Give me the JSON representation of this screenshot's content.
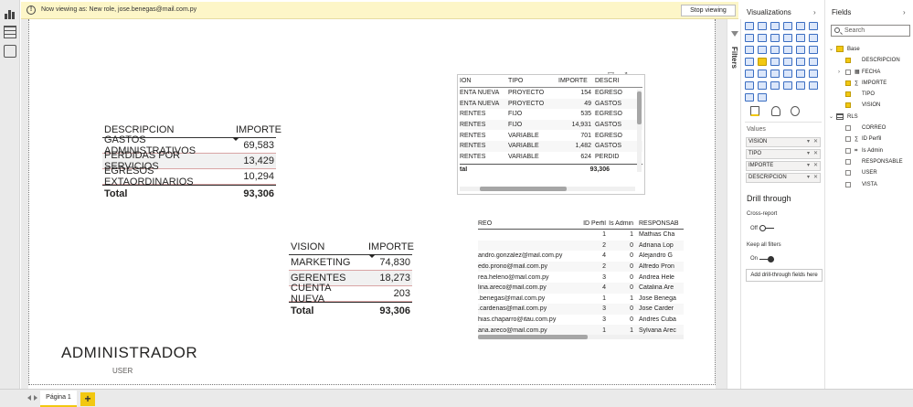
{
  "banner": {
    "text": "Now viewing as: New role, jose.benegas@mail.com.py",
    "stop_button": "Stop viewing"
  },
  "table_descripcion": {
    "headers": [
      "DESCRIPCION",
      "IMPORTE"
    ],
    "rows": [
      {
        "label": "GASTOS ADMINISTRATIVOS",
        "value": "69,583"
      },
      {
        "label": "PERDIDAS POR SERVICIOS",
        "value": "13,429"
      },
      {
        "label": "EGRESOS EXTAORDINARIOS",
        "value": "10,294"
      }
    ],
    "total_label": "Total",
    "total_value": "93,306"
  },
  "table_vision": {
    "headers": [
      "VISION",
      "IMPORTE"
    ],
    "rows": [
      {
        "label": "MARKETING",
        "value": "74,830"
      },
      {
        "label": "GERENTES",
        "value": "18,273"
      },
      {
        "label": "CUENTA NUEVA",
        "value": "203"
      }
    ],
    "total_label": "Total",
    "total_value": "93,306"
  },
  "table_detail": {
    "headers": [
      "ION",
      "TIPO",
      "IMPORTE",
      "DESCRI"
    ],
    "rows": [
      [
        "ENTA NUEVA",
        "PROYECTO",
        "154",
        "EGRESOS"
      ],
      [
        "ENTA NUEVA",
        "PROYECTO",
        "49",
        "GASTOS"
      ],
      [
        "RENTES",
        "FIJO",
        "535",
        "EGRESO"
      ],
      [
        "RENTES",
        "FIJO",
        "14,931",
        "GASTOS"
      ],
      [
        "RENTES",
        "VARIABLE",
        "701",
        "EGRESO"
      ],
      [
        "RENTES",
        "VARIABLE",
        "1,482",
        "GASTOS"
      ],
      [
        "RENTES",
        "VARIABLE",
        "624",
        "PERDID"
      ]
    ],
    "total_label": "tal",
    "total_value": "93,306"
  },
  "table_users": {
    "headers": [
      "REO",
      "ID Perfil",
      "Is Admin",
      "RESPONSAB"
    ],
    "rows": [
      [
        "",
        "1",
        "1",
        "Mathias Cha"
      ],
      [
        "",
        "2",
        "0",
        "Adriana Lop"
      ],
      [
        "andro.gonzalez@mail.com.py",
        "4",
        "0",
        "Alejandro G"
      ],
      [
        "edo.prono@mail.com.py",
        "2",
        "0",
        "Alfredo Pron"
      ],
      [
        "rea.heleno@mail.com.py",
        "3",
        "0",
        "Andrea Hele"
      ],
      [
        "lina.areco@mail.com.py",
        "4",
        "0",
        "Catalina Are"
      ],
      [
        ".benegas@mail.com.py",
        "1",
        "1",
        "Jose Benega"
      ],
      [
        ".cardenas@mail.com.py",
        "3",
        "0",
        "Jose Carder"
      ],
      [
        "hias.chaparro@itau.com.py",
        "3",
        "0",
        "Andres Cuba"
      ],
      [
        "ana.areco@mail.com.py",
        "1",
        "1",
        "Sylvana Arec"
      ]
    ]
  },
  "card_admin": {
    "value": "ADMINISTRADOR",
    "label": "USER"
  },
  "bottom": {
    "page_tab": "Página 1",
    "add_page": "+"
  },
  "filters": {
    "label": "Filters"
  },
  "visualizations": {
    "title": "Visualizations",
    "values_label": "Values",
    "wells": [
      "VISION",
      "TIPO",
      "IMPORTE",
      "DESCRIPCION"
    ],
    "drill_title": "Drill through",
    "cross_report": "Cross-report",
    "cross_report_state": "Off",
    "keep_filters": "Keep all filters",
    "keep_filters_state": "On",
    "add_drill_button": "Add drill-through fields here"
  },
  "fields": {
    "title": "Fields",
    "search_placeholder": "Search",
    "tables": [
      {
        "name": "Base",
        "items": [
          {
            "name": "DESCRIPCION",
            "checked": true
          },
          {
            "name": "FECHA",
            "checked": false
          },
          {
            "name": "IMPORTE",
            "checked": true
          },
          {
            "name": "TIPO",
            "checked": true
          },
          {
            "name": "VISION",
            "checked": true
          }
        ]
      },
      {
        "name": "RLS",
        "items": [
          {
            "name": "CORREO",
            "checked": false
          },
          {
            "name": "ID Perfil",
            "checked": false
          },
          {
            "name": "Is Admin",
            "checked": false
          },
          {
            "name": "RESPONSABLE",
            "checked": false
          },
          {
            "name": "USER",
            "checked": false
          },
          {
            "name": "VISTA",
            "checked": false
          }
        ]
      }
    ]
  },
  "colors": {
    "accent": "#f2c811",
    "banner_bg": "#fdf6c8",
    "row_separator": "#d9a5a5"
  }
}
